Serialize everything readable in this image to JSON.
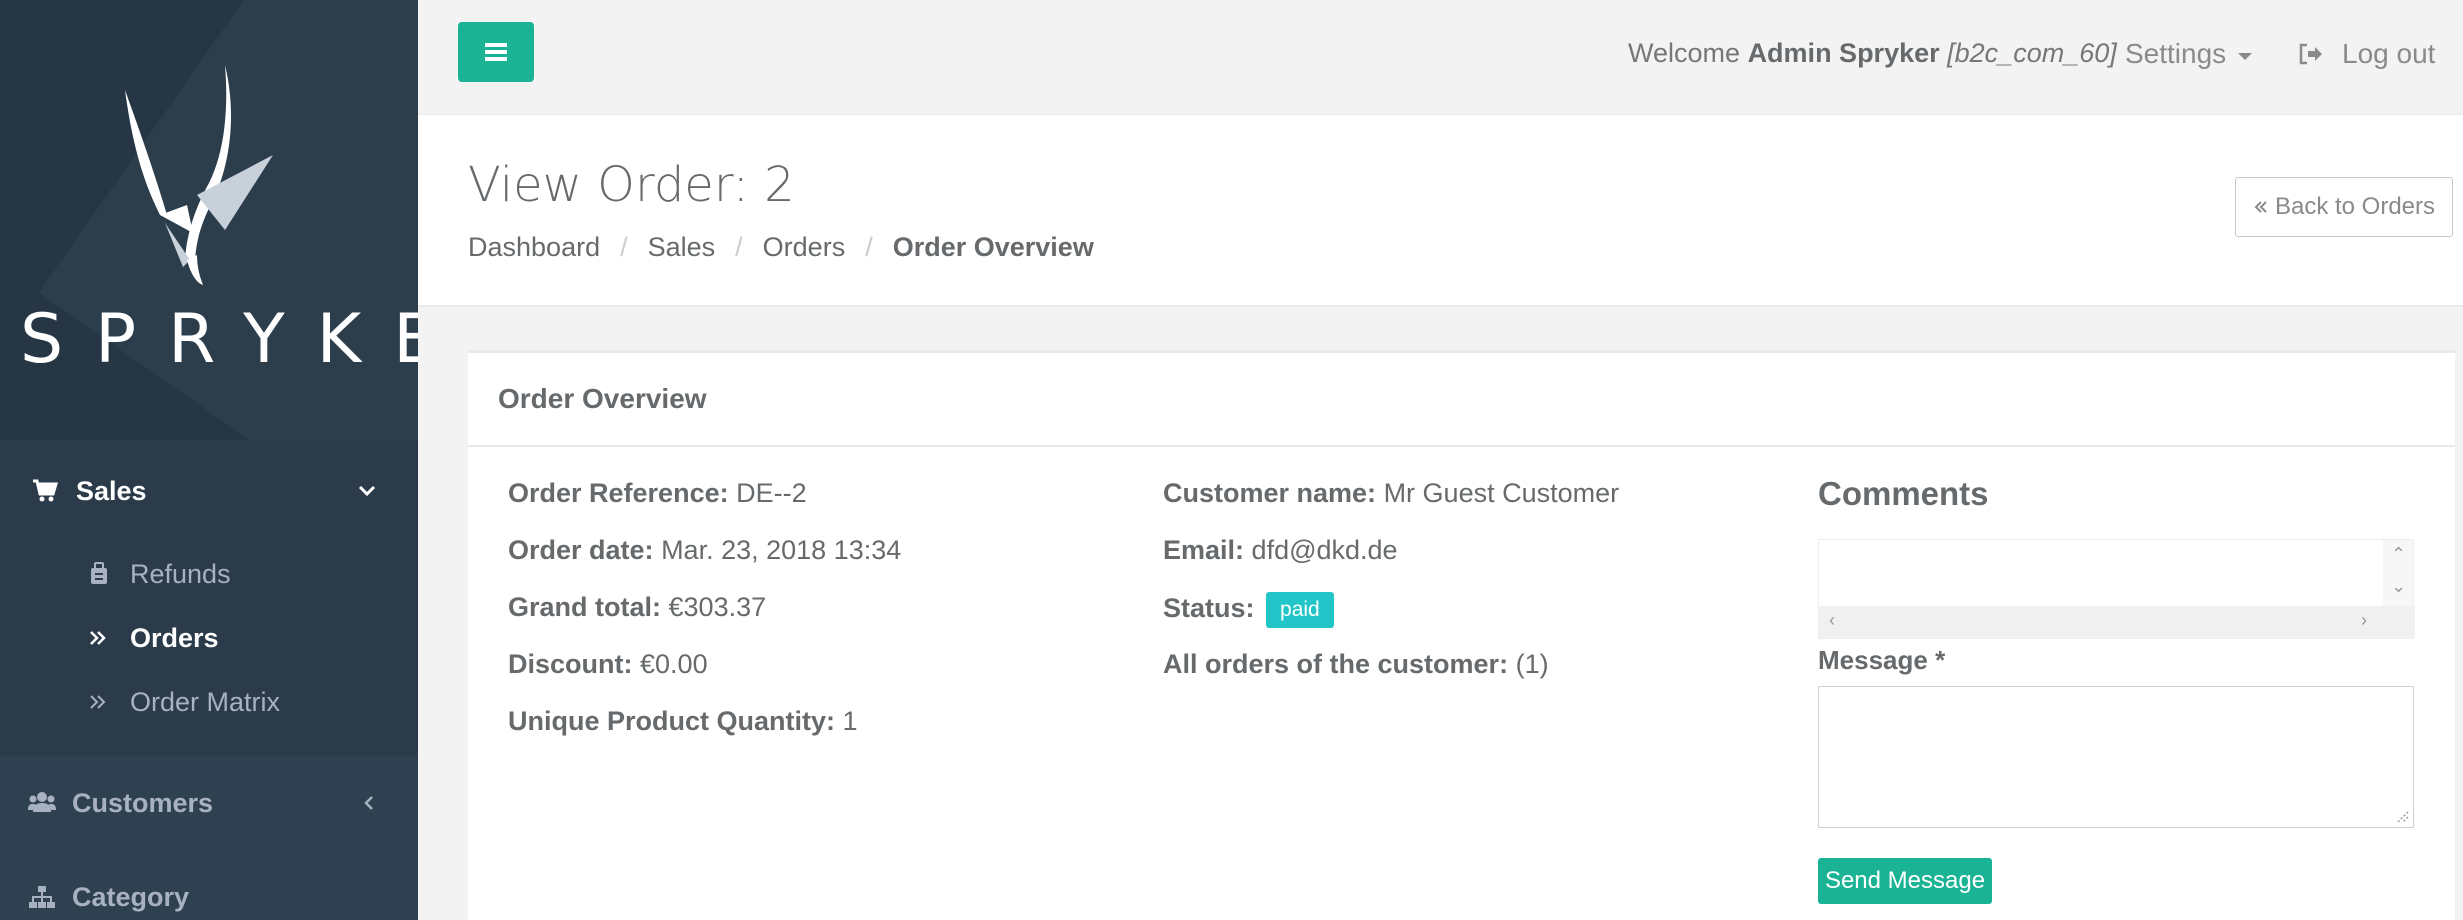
{
  "brand": {
    "name": "SPRYKER"
  },
  "sidebar": {
    "sales": {
      "label": "Sales"
    },
    "sales_items": [
      {
        "label": "Refunds",
        "icon": "refund-icon"
      },
      {
        "label": "Orders",
        "icon": "double-chevron-right-icon"
      },
      {
        "label": "Order Matrix",
        "icon": "double-chevron-right-icon"
      }
    ],
    "customers": {
      "label": "Customers"
    },
    "category": {
      "label": "Category"
    }
  },
  "topbar": {
    "welcome_prefix": "Welcome",
    "user_name": "Admin Spryker",
    "store": "[b2c_com_60]",
    "settings_label": "Settings",
    "logout_label": "Log out"
  },
  "heading": {
    "title": "View Order: 2",
    "breadcrumb": [
      "Dashboard",
      "Sales",
      "Orders",
      "Order Overview"
    ],
    "back_label": "Back to Orders"
  },
  "panel": {
    "title": "Order Overview",
    "left": [
      {
        "label": "Order Reference:",
        "value": "DE--2"
      },
      {
        "label": "Order date:",
        "value": "Mar. 23, 2018 13:34"
      },
      {
        "label": "Grand total:",
        "value": "€303.37"
      },
      {
        "label": "Discount:",
        "value": "€0.00"
      },
      {
        "label": "Unique Product Quantity:",
        "value": "1"
      }
    ],
    "middle": {
      "customer_name_label": "Customer name:",
      "customer_name": "Mr Guest Customer",
      "email_label": "Email:",
      "email": "dfd@dkd.de",
      "status_label": "Status:",
      "status": "paid",
      "all_orders_label": "All orders of the customer:",
      "all_orders": "(1)"
    },
    "comments": {
      "title": "Comments",
      "message_label": "Message *",
      "send_label": "Send Message"
    }
  },
  "colors": {
    "sidebar": "#2f4050",
    "primary": "#1ab394",
    "badge": "#23c6c8",
    "text": "#676a6c"
  }
}
